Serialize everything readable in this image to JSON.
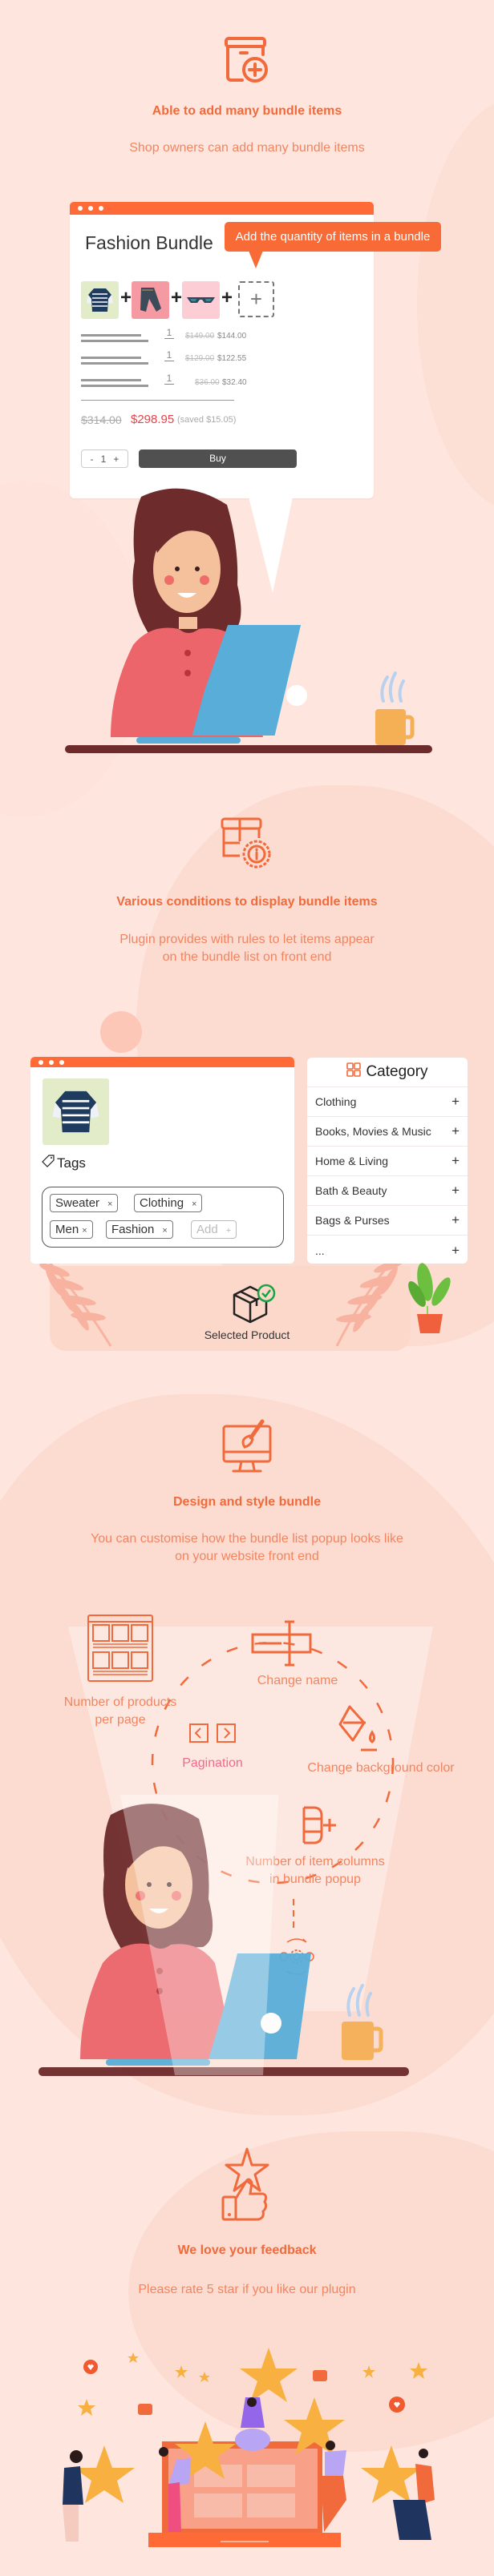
{
  "colors": {
    "background": "#fee6df",
    "accent": "#f06a3c",
    "tooltip": "#f86a36",
    "price_red": "#e9414a",
    "buy_button": "#505050"
  },
  "sections": [
    {
      "icon": "box-add-icon",
      "title": "Able to add many bundle items",
      "description": "Shop owners can add many bundle items"
    },
    {
      "icon": "box-settings-info-icon",
      "title": "Various conditions to display bundle items",
      "description_lines": [
        "Plugin provides with rules to let items appear",
        "on the bundle list on front end"
      ]
    },
    {
      "icon": "monitor-brush-icon",
      "title": "Design and style bundle",
      "description_lines": [
        "You can customise how the bundle list popup looks like",
        "on your website front end"
      ]
    },
    {
      "icon": "thumbs-up-star-icon",
      "title": "We love your feedback",
      "description": "Please rate 5 star if you like our plugin"
    }
  ],
  "bundle_card": {
    "title": "Fashion Bundle",
    "tooltip": "Add the quantity of items in a bundle",
    "products": [
      {
        "name": "striped-sweater",
        "qty": "1",
        "old_price": "$149.00",
        "new_price": "$144.00"
      },
      {
        "name": "jeans",
        "qty": "1",
        "old_price": "$129.00",
        "new_price": "$122.55"
      },
      {
        "name": "sunglasses",
        "qty": "1",
        "old_price": "$36.00",
        "new_price": "$32.40"
      }
    ],
    "add_slot": "+",
    "total_old": "$314.00",
    "total_new": "$298.95",
    "total_saved": "(saved $15.05)",
    "stepper": {
      "minus": "-",
      "value": "1",
      "plus": "+"
    },
    "buy_label": "Buy"
  },
  "tags_card": {
    "label": "Tags",
    "tags": [
      "Sweater",
      "Clothing",
      "Men",
      "Fashion"
    ],
    "add_placeholder": "Add",
    "remove_glyph": "×",
    "add_glyph": "+"
  },
  "category_card": {
    "title": "Category",
    "items": [
      "Clothing",
      "Books, Movies & Music",
      "Home & Living",
      "Bath & Beauty",
      "Bags & Purses",
      "..."
    ],
    "expand_glyph": "+"
  },
  "selected_product_label": "Selected Product",
  "design_features": {
    "products_per_page": [
      "Number of products",
      "per page"
    ],
    "change_name": "Change name",
    "pagination": "Pagination",
    "change_background": "Change background color",
    "item_columns": [
      "Number of item columns",
      "in bundle popup"
    ]
  }
}
